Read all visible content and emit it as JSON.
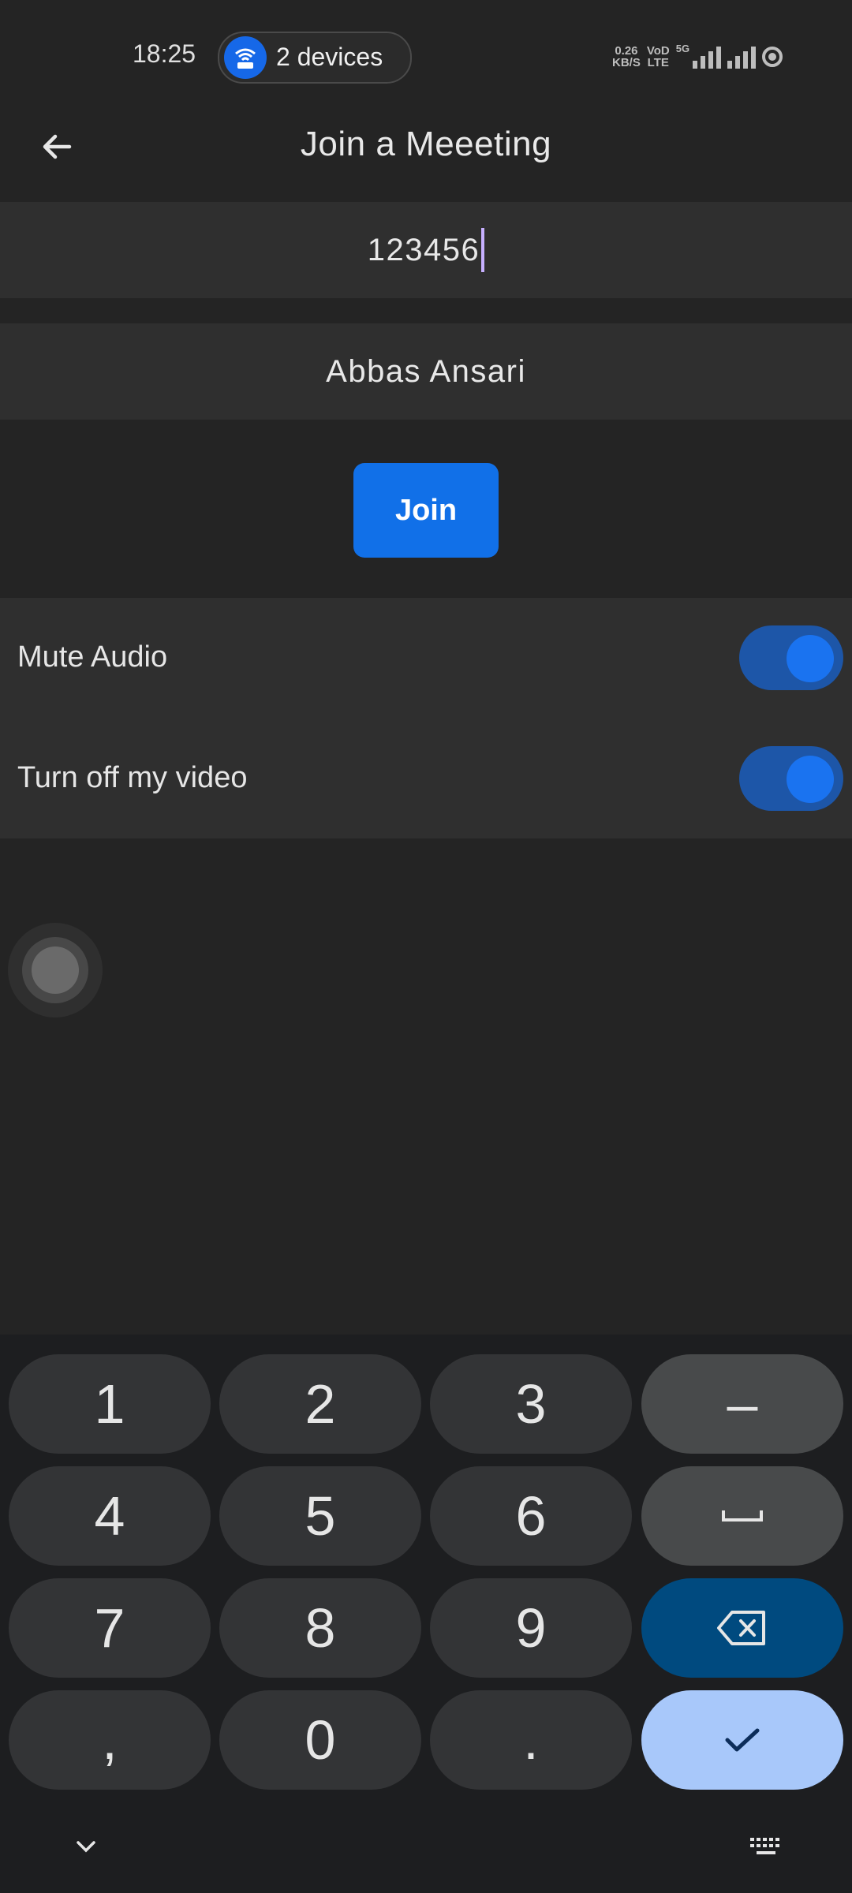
{
  "status_bar": {
    "time": "18:25",
    "hotspot_label": "2 devices",
    "speed_value": "0.26",
    "speed_unit": "KB/S",
    "volte_top": "VoD",
    "volte_bottom": "LTE",
    "network": "5G"
  },
  "app_bar": {
    "title": "Join a Meeeting",
    "back_icon": "arrow-left-icon"
  },
  "form": {
    "meeting_id_value": "123456",
    "name_value": "Abbas Ansari",
    "join_label": "Join"
  },
  "options": {
    "mute_audio_label": "Mute Audio",
    "mute_audio_on": true,
    "video_off_label": "Turn off my video",
    "video_off_on": true
  },
  "keyboard": {
    "keys": [
      "1",
      "2",
      "3",
      "–",
      "4",
      "5",
      "6",
      "␣",
      "7",
      "8",
      "9",
      "⌫",
      ",",
      "0",
      ".",
      "✓"
    ],
    "hide_icon": "chevron-down-icon",
    "switch_icon": "keyboard-icon"
  },
  "colors": {
    "background": "#242424",
    "field": "#2f2f2f",
    "accent": "#1170e8",
    "switch_track": "#1d56a8",
    "caret": "#c7b0ff",
    "key": "#333436",
    "key_fn": "#484a4b",
    "key_delete": "#004a7f",
    "key_enter": "#a8c8fa"
  }
}
